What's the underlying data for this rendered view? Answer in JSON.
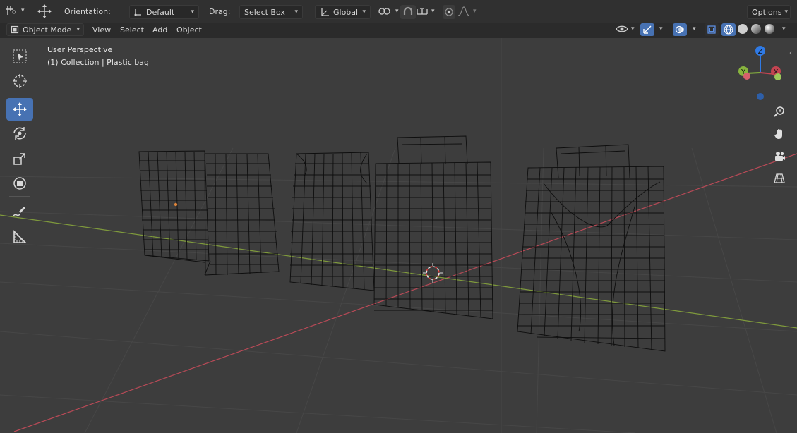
{
  "header": {
    "orientation_label": "Orientation:",
    "orientation_value": "Default",
    "drag_label": "Drag:",
    "drag_value": "Select Box",
    "transform_space": "Global",
    "options_label": "Options"
  },
  "menubar": {
    "mode": "Object Mode",
    "view": "View",
    "select": "Select",
    "add": "Add",
    "object": "Object"
  },
  "viewport": {
    "perspective_label": "User Perspective",
    "collection_label": "(1) Collection | Plastic bag",
    "gizmo": {
      "z": "Z",
      "y": "Y",
      "x": "X"
    }
  },
  "toolbar": {
    "tools": [
      "select-box",
      "cursor",
      "move",
      "rotate",
      "scale",
      "transform",
      "annotate",
      "measure"
    ],
    "active_tool": "move"
  },
  "colors": {
    "accent": "#4772b3",
    "axis_x": "#c34451",
    "axis_y": "#88b43e",
    "axis_z": "#2f7ae5",
    "wire": "#000000",
    "viewport_bg": "#3d3d3d"
  }
}
